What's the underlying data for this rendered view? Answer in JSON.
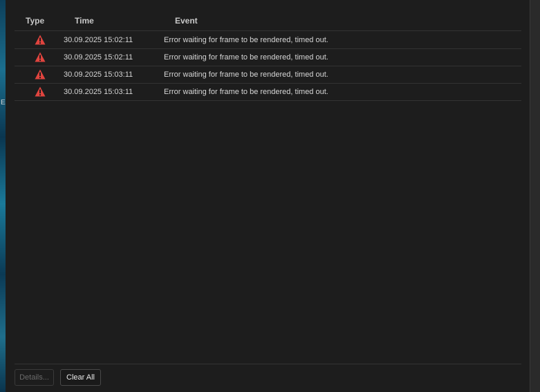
{
  "desktop": {
    "edge_glyph": "E"
  },
  "columns": {
    "type": "Type",
    "time": "Time",
    "event": "Event"
  },
  "rows": [
    {
      "type_icon": "warning-icon",
      "time": "30.09.2025 15:02:11",
      "event": "Error waiting for frame to be rendered, timed out."
    },
    {
      "type_icon": "warning-icon",
      "time": "30.09.2025 15:02:11",
      "event": "Error waiting for frame to be rendered, timed out."
    },
    {
      "type_icon": "warning-icon",
      "time": "30.09.2025 15:03:11",
      "event": "Error waiting for frame to be rendered, timed out."
    },
    {
      "type_icon": "warning-icon",
      "time": "30.09.2025 15:03:11",
      "event": "Error waiting for frame to be rendered, timed out."
    }
  ],
  "buttons": {
    "details": "Details...",
    "clear_all": "Clear All"
  },
  "colors": {
    "warning": "#e0443e",
    "background": "#1d1d1d"
  }
}
